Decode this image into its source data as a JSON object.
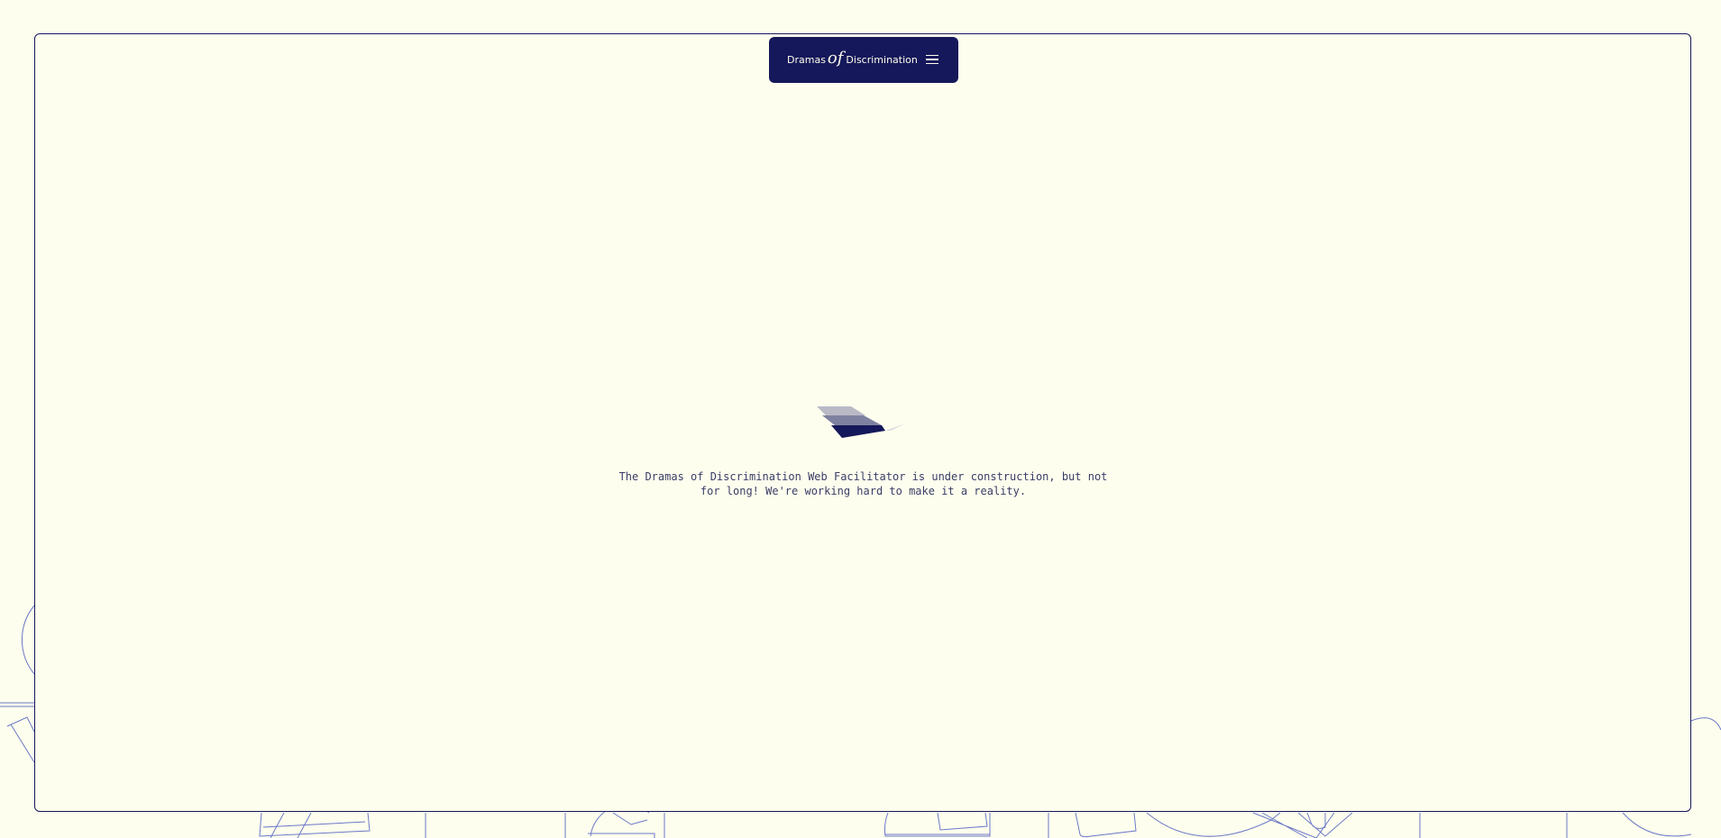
{
  "header": {
    "brand_prefix": "Dramas",
    "brand_of": "of",
    "brand_suffix": "Discrimination",
    "menu_icon": "hamburger-menu-icon"
  },
  "main": {
    "loader_icon": "stacked-planes-loader-icon",
    "message": "The Dramas of Discrimination Web Facilitator is under construction, but not for long! We're working hard to make it a reality."
  },
  "colors": {
    "background": "#fefeee",
    "primary": "#15185a",
    "line_art": "#6a78c8",
    "text": "#3a3d66"
  }
}
